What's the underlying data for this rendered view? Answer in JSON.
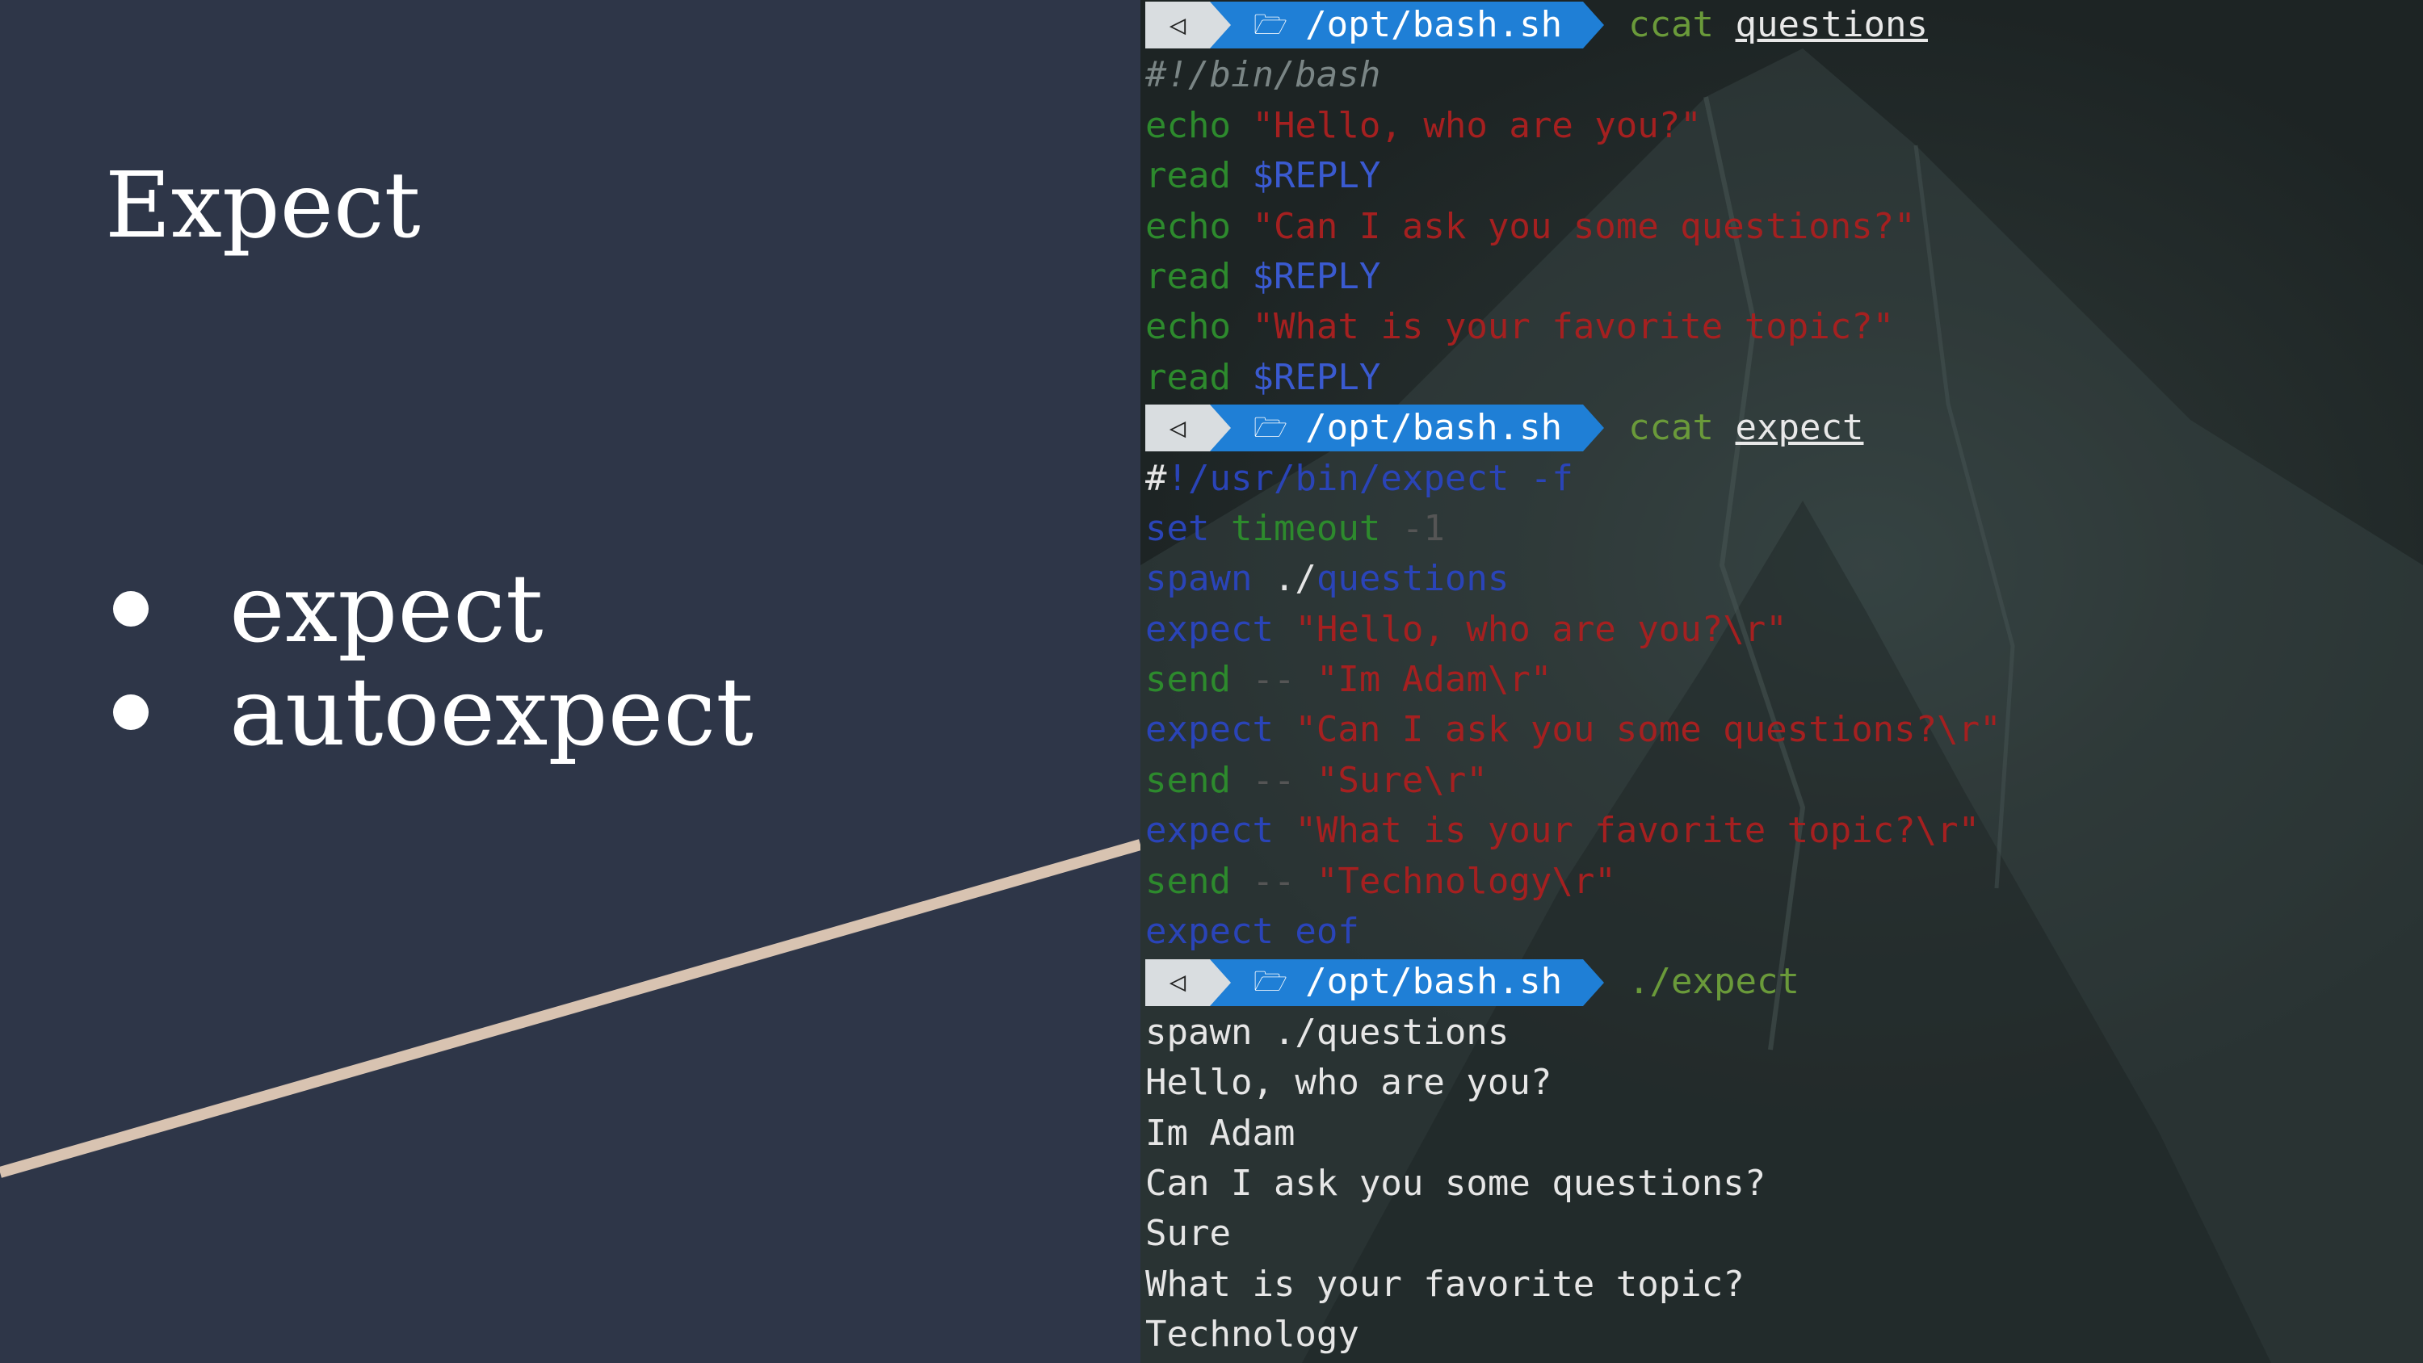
{
  "slide": {
    "title": "Expect",
    "bullets": [
      "expect",
      "autoexpect"
    ]
  },
  "terminal": {
    "prompts": [
      {
        "icon": "◁",
        "folder_icon": "🗁",
        "path": "/opt/bash.sh",
        "command": "ccat",
        "argument": "questions"
      },
      {
        "icon": "◁",
        "folder_icon": "🗁",
        "path": "/opt/bash.sh",
        "command": "ccat",
        "argument": "expect"
      },
      {
        "icon": "◁",
        "folder_icon": "🗁",
        "path": "/opt/bash.sh",
        "command": "./expect",
        "argument": ""
      }
    ],
    "questions_file": [
      {
        "a": "#!/bin/bash",
        "b": ""
      },
      {
        "a": "echo",
        "b": " \"Hello, who are you?\""
      },
      {
        "a": "read",
        "b": " $REPLY"
      },
      {
        "a": "echo",
        "b": " \"Can I ask you some questions?\""
      },
      {
        "a": "read",
        "b": " $REPLY"
      },
      {
        "a": "echo",
        "b": " \"What is your favorite topic?\""
      },
      {
        "a": "read",
        "b": " $REPLY"
      }
    ],
    "expect_file": [
      {
        "a": "#",
        "b": "!/usr/bin/expect -f"
      },
      {
        "a": "set",
        "b": " timeout",
        "c": " -1"
      },
      {
        "a": "spawn",
        "b": " ./",
        "c": "questions"
      },
      {
        "a": "expect",
        "b": " \"Hello, who are you?\\r\""
      },
      {
        "a": "send",
        "b": " -- ",
        "c": "\"Im Adam\\r\""
      },
      {
        "a": "expect",
        "b": " \"Can I ask you some questions?\\r\""
      },
      {
        "a": "send",
        "b": " -- ",
        "c": "\"Sure\\r\""
      },
      {
        "a": "expect",
        "b": " \"What is your favorite topic?\\r\""
      },
      {
        "a": "send",
        "b": " -- ",
        "c": "\"Technology\\r\""
      },
      {
        "a": "expect eof",
        "b": ""
      }
    ],
    "output": [
      "spawn ./questions",
      "Hello, who are you?",
      "Im Adam",
      "Can I ask you some questions?",
      "Sure",
      "What is your favorite topic?",
      "Technology"
    ]
  }
}
